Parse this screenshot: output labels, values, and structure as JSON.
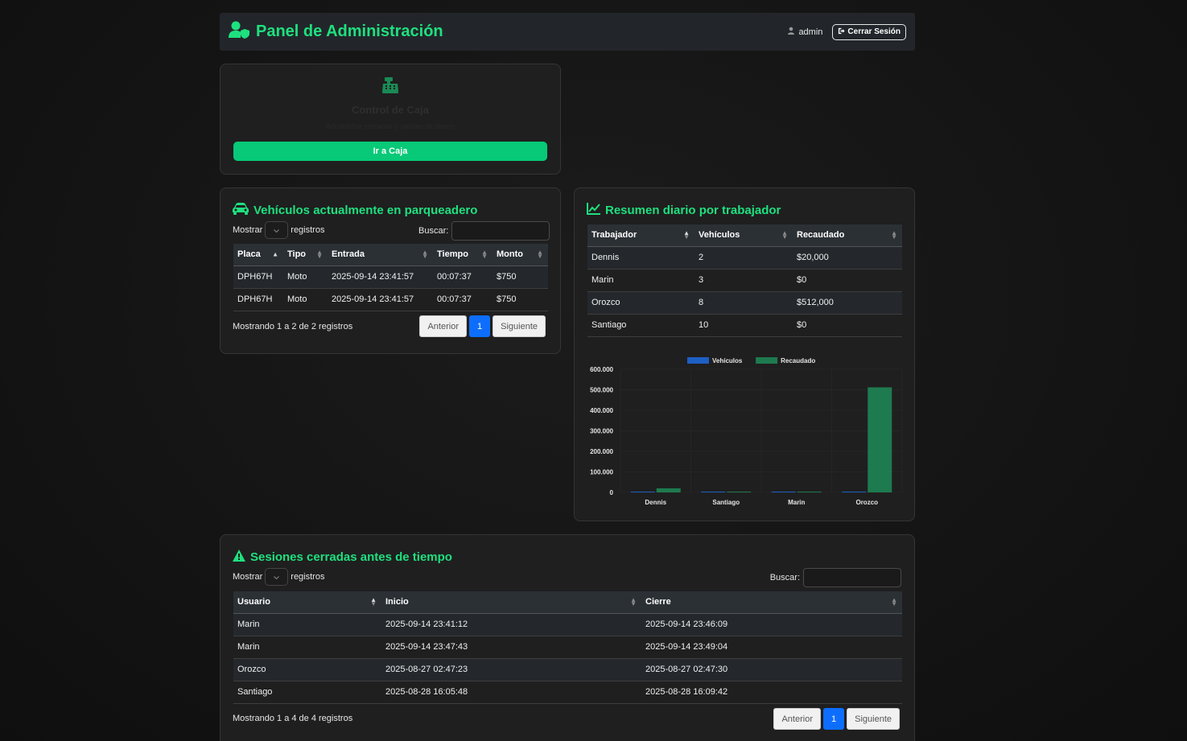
{
  "header": {
    "title": "Panel de Administración",
    "user": "admin",
    "logout_label": "Cerrar Sesión"
  },
  "caja": {
    "title": "Control de Caja",
    "subtitle": "Administrar entradas y salidas de dinero",
    "button_label": "Ir a Caja"
  },
  "vehiculos": {
    "title": "Vehículos actualmente en parqueadero",
    "show_label": "Mostrar",
    "records_label": "registros",
    "search_label": "Buscar:",
    "columns": [
      "Placa",
      "Tipo",
      "Entrada",
      "Tiempo",
      "Monto"
    ],
    "rows": [
      [
        "DPH67H",
        "Moto",
        "2025-09-14 23:41:57",
        "00:07:37",
        "$750"
      ],
      [
        "DPH67H",
        "Moto",
        "2025-09-14 23:41:57",
        "00:07:37",
        "$750"
      ]
    ],
    "info": "Mostrando 1 a 2 de 2 registros",
    "prev_label": "Anterior",
    "page": "1",
    "next_label": "Siguiente"
  },
  "resumen": {
    "title": "Resumen diario por trabajador",
    "columns": [
      "Trabajador",
      "Vehículos",
      "Recaudado"
    ],
    "rows": [
      [
        "Dennis",
        "2",
        "$20,000"
      ],
      [
        "Marin",
        "3",
        "$0"
      ],
      [
        "Orozco",
        "8",
        "$512,000"
      ],
      [
        "Santiago",
        "10",
        "$0"
      ]
    ]
  },
  "chart_data": {
    "type": "bar",
    "categories": [
      "Dennis",
      "Santiago",
      "Marin",
      "Orozco"
    ],
    "series": [
      {
        "name": "Vehículos",
        "values": [
          2,
          10,
          3,
          8
        ],
        "color": "#1d5fc4"
      },
      {
        "name": "Recaudado",
        "values": [
          20000,
          0,
          0,
          512000
        ],
        "color": "#1e7a4f"
      }
    ],
    "yticks": [
      "600.000",
      "500.000",
      "400.000",
      "300.000",
      "200.000",
      "100.000",
      "0"
    ],
    "ylim": [
      0,
      600000
    ],
    "legend": "top",
    "grid": true
  },
  "sesiones": {
    "title": "Sesiones cerradas antes de tiempo",
    "show_label": "Mostrar",
    "records_label": "registros",
    "search_label": "Buscar:",
    "columns": [
      "Usuario",
      "Inicio",
      "Cierre"
    ],
    "rows": [
      [
        "Marin",
        "2025-09-14 23:41:12",
        "2025-09-14 23:46:09"
      ],
      [
        "Marin",
        "2025-09-14 23:47:43",
        "2025-09-14 23:49:04"
      ],
      [
        "Orozco",
        "2025-08-27 02:47:23",
        "2025-08-27 02:47:30"
      ],
      [
        "Santiago",
        "2025-08-28 16:05:48",
        "2025-08-28 16:09:42"
      ]
    ],
    "info": "Mostrando 1 a 4 de 4 registros",
    "prev_label": "Anterior",
    "page": "1",
    "next_label": "Siguiente"
  }
}
